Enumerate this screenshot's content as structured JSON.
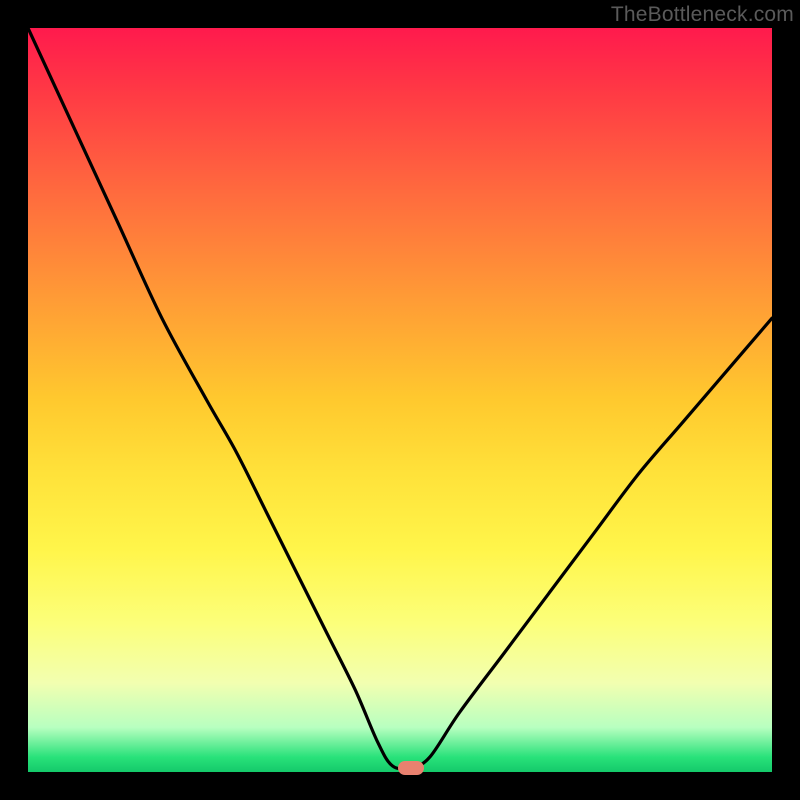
{
  "watermark": "TheBottleneck.com",
  "marker": {
    "x_pct": 51.5,
    "y_pct": 99.4,
    "color": "#e9816f"
  },
  "chart_data": {
    "type": "line",
    "title": "",
    "xlabel": "",
    "ylabel": "",
    "xlim": [
      0,
      100
    ],
    "ylim": [
      0,
      100
    ],
    "grid": false,
    "legend": false,
    "series": [
      {
        "name": "bottleneck-curve",
        "x": [
          0,
          6,
          12,
          18,
          24,
          28,
          32,
          36,
          40,
          44,
          47,
          49,
          51.5,
          54,
          58,
          64,
          70,
          76,
          82,
          88,
          94,
          100
        ],
        "y": [
          100,
          87,
          74,
          61,
          50,
          43,
          35,
          27,
          19,
          11,
          4,
          0.8,
          0.6,
          2,
          8,
          16,
          24,
          32,
          40,
          47,
          54,
          61
        ]
      }
    ],
    "annotations": []
  }
}
